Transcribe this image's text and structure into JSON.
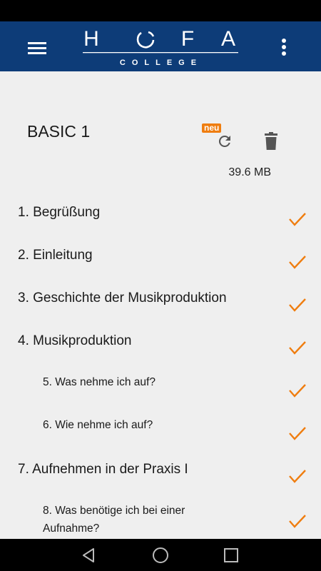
{
  "app_bar": {
    "logo_letters": [
      "H",
      "O",
      "F",
      "A"
    ],
    "logo_subtitle": "COLLEGE",
    "background_color": "#0d3c78"
  },
  "course": {
    "title": "BASIC 1",
    "badge": "neu",
    "size": "39.6 MB",
    "accent_color": "#ef7d0f"
  },
  "lessons": [
    {
      "label": "1. Begrüßung",
      "level": "main",
      "completed": true
    },
    {
      "label": "2. Einleitung",
      "level": "main",
      "completed": true
    },
    {
      "label": "3. Geschichte der Musikproduktion",
      "level": "main",
      "completed": true
    },
    {
      "label": "4. Musikproduktion",
      "level": "main",
      "completed": true
    },
    {
      "label": "5. Was nehme ich auf?",
      "level": "sub",
      "completed": true
    },
    {
      "label": "6. Wie nehme ich auf?",
      "level": "sub",
      "completed": true
    },
    {
      "label": "7. Aufnehmen in der Praxis I",
      "level": "main",
      "completed": true
    },
    {
      "label": "8. Was benötige ich bei einer Aufnahme?",
      "level": "sub",
      "completed": true
    }
  ],
  "icons": {
    "menu": "hamburger-menu-icon",
    "more": "more-vertical-icon",
    "refresh": "refresh-icon",
    "delete": "trash-icon",
    "check": "checkmark-icon",
    "nav_back": "triangle-back-icon",
    "nav_home": "circle-home-icon",
    "nav_recents": "square-recents-icon"
  }
}
